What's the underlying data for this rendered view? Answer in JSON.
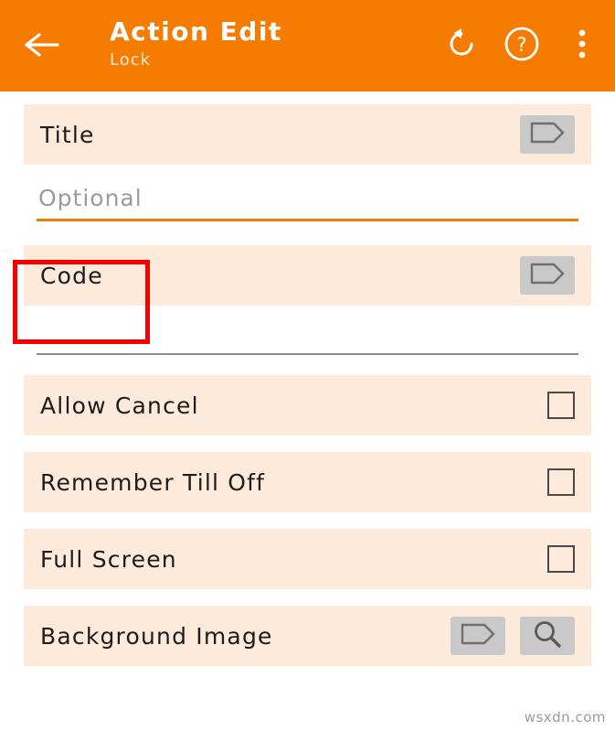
{
  "appbar": {
    "title": "Action Edit",
    "subtitle": "Lock",
    "back_icon": "arrow-left-icon",
    "undo_icon": "undo-icon",
    "help_icon": "help-circle-icon",
    "overflow_icon": "more-vertical-icon",
    "background_color": "#f57c00"
  },
  "rows": {
    "title": {
      "label": "Title",
      "tag_icon": "tag-icon"
    },
    "title_input": {
      "value": "",
      "placeholder": "Optional",
      "underline_color": "#f57c00"
    },
    "code": {
      "label": "Code",
      "tag_icon": "tag-icon",
      "highlighted": true,
      "highlight_color": "#f70000"
    },
    "allow_cancel": {
      "label": "Allow Cancel",
      "checked": false
    },
    "remember_till_off": {
      "label": "Remember Till Off",
      "checked": false
    },
    "full_screen": {
      "label": "Full Screen",
      "checked": false
    },
    "background_image": {
      "label": "Background Image",
      "tag_icon": "tag-icon",
      "search_icon": "search-icon"
    }
  },
  "watermark": "wsxdn.com"
}
